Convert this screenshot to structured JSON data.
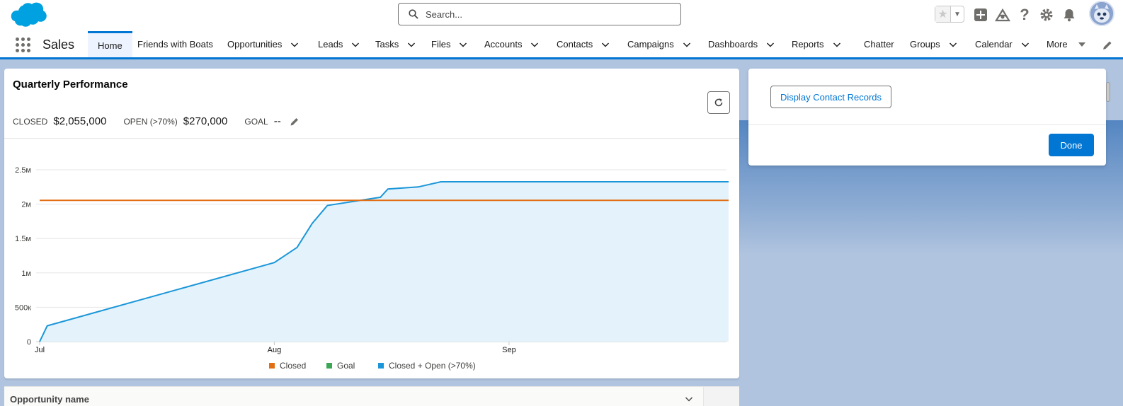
{
  "header": {
    "search_placeholder": "Search...",
    "icons": [
      "salesforce-cloud-logo",
      "favorites-star-icon",
      "favorites-caret-icon",
      "global-add-icon",
      "trailhead-icon",
      "help-icon",
      "setup-gear-icon",
      "notifications-bell-icon",
      "user-avatar"
    ]
  },
  "nav": {
    "app_name": "Sales",
    "items": [
      {
        "label": "Home",
        "has_menu": false
      },
      {
        "label": "Friends with Boats",
        "has_menu": false
      },
      {
        "label": "Opportunities",
        "has_menu": true
      },
      {
        "label": "Leads",
        "has_menu": true
      },
      {
        "label": "Tasks",
        "has_menu": true
      },
      {
        "label": "Files",
        "has_menu": true
      },
      {
        "label": "Accounts",
        "has_menu": true
      },
      {
        "label": "Contacts",
        "has_menu": true
      },
      {
        "label": "Campaigns",
        "has_menu": true
      },
      {
        "label": "Dashboards",
        "has_menu": true
      },
      {
        "label": "Reports",
        "has_menu": true
      },
      {
        "label": "Chatter",
        "has_menu": false
      },
      {
        "label": "Groups",
        "has_menu": true
      },
      {
        "label": "Calendar",
        "has_menu": true
      },
      {
        "label": "More",
        "has_menu": true
      }
    ]
  },
  "card": {
    "title": "Quarterly Performance",
    "closed_label": "CLOSED",
    "closed_value": "$2,055,000",
    "open_label": "OPEN (>70%)",
    "open_value": "$270,000",
    "goal_label": "GOAL",
    "goal_value": "--"
  },
  "panel": {
    "contact_button": "Display Contact Records",
    "done_button": "Done"
  },
  "table": {
    "first_column": "Opportunity name"
  },
  "colors": {
    "brand": "#0176d3",
    "closed": "#e26e13",
    "goal": "#3ba755",
    "closed_open": "#1b96d8"
  },
  "chart_data": {
    "type": "area",
    "title": "",
    "x_ticks": [
      "Jul",
      "Aug",
      "Sep"
    ],
    "y_ticks": [
      "0",
      "500к",
      "1м",
      "1.5м",
      "2м",
      "2.5м"
    ],
    "ylim": [
      0,
      2500000
    ],
    "series": [
      {
        "name": "Closed",
        "color": "#e26e13",
        "type": "line",
        "x": [
          "2023-07-01",
          "2023-09-30"
        ],
        "y": [
          2055000,
          2055000
        ]
      },
      {
        "name": "Goal",
        "color": "#3ba755",
        "type": "line",
        "x": [],
        "y": []
      },
      {
        "name": "Closed + Open (>70%)",
        "color": "#1b96d8",
        "type": "area",
        "x": [
          "2023-07-01",
          "2023-07-02",
          "2023-08-01",
          "2023-08-04",
          "2023-08-06",
          "2023-08-08",
          "2023-08-15",
          "2023-08-16",
          "2023-08-20",
          "2023-08-23",
          "2023-09-30"
        ],
        "y": [
          0,
          230000,
          1150000,
          1370000,
          1720000,
          1980000,
          2100000,
          2220000,
          2250000,
          2325000,
          2325000
        ]
      }
    ],
    "legend": [
      "Closed",
      "Goal",
      "Closed + Open (>70%)"
    ],
    "legend_position": "bottom",
    "grid": true
  }
}
